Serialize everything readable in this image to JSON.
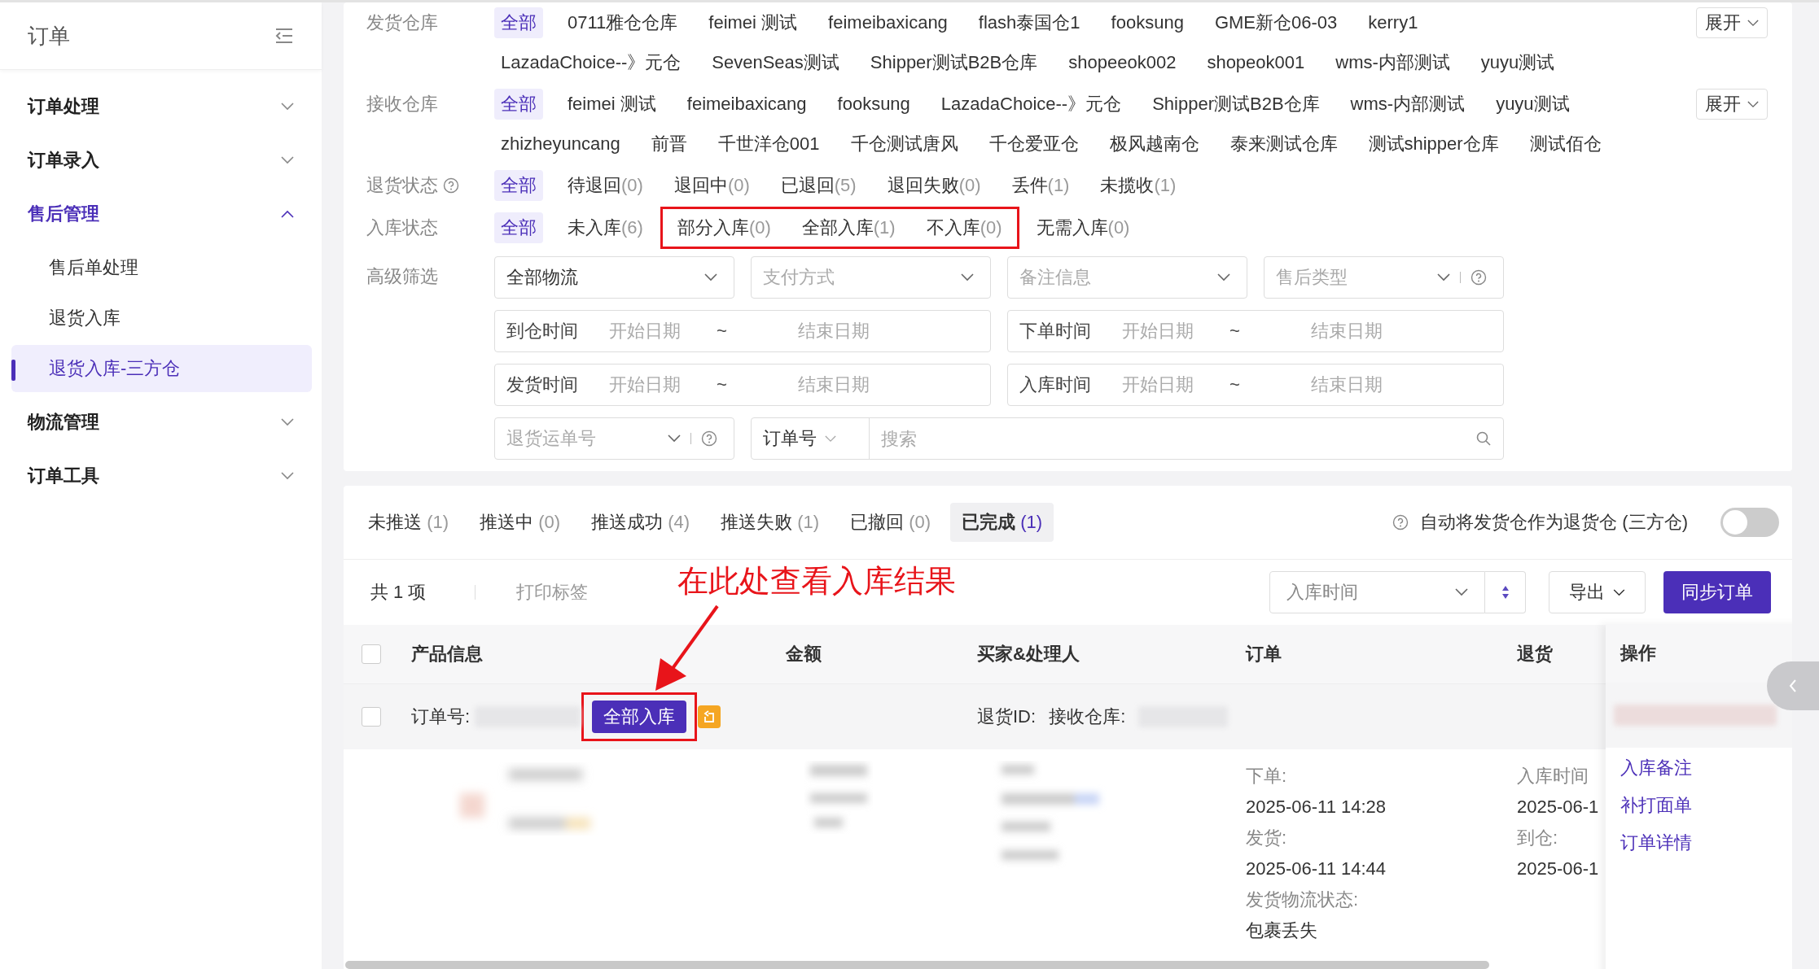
{
  "sidebar": {
    "title": "订单",
    "items": [
      {
        "label": "订单处理",
        "expanded": false
      },
      {
        "label": "订单录入",
        "expanded": false
      },
      {
        "label": "售后管理",
        "expanded": true,
        "children": [
          {
            "label": "售后单处理",
            "selected": false
          },
          {
            "label": "退货入库",
            "selected": false
          },
          {
            "label": "退货入库-三方仓",
            "selected": true
          }
        ]
      },
      {
        "label": "物流管理",
        "expanded": false
      },
      {
        "label": "订单工具",
        "expanded": false
      }
    ]
  },
  "filters": [
    {
      "label": "发货仓库",
      "expand_button": "展开",
      "options": [
        {
          "label": "全部",
          "selected": true
        },
        {
          "label": "0711雅仓仓库",
          "selected": false
        },
        {
          "label": "feimei 测试",
          "selected": false
        },
        {
          "label": "feimeibaxicang",
          "selected": false
        },
        {
          "label": "flash泰国仓1",
          "selected": false
        },
        {
          "label": "fooksung",
          "selected": false
        },
        {
          "label": "GME新仓06-03",
          "selected": false
        },
        {
          "label": "kerry1",
          "selected": false
        },
        {
          "label": "LazadaChoice--》元仓",
          "selected": false
        },
        {
          "label": "SevenSeas测试",
          "selected": false
        },
        {
          "label": "Shipper测试B2B仓库",
          "selected": false
        },
        {
          "label": "shopeeok002",
          "selected": false
        },
        {
          "label": "shopeok001",
          "selected": false
        },
        {
          "label": "wms-内部测试",
          "selected": false
        },
        {
          "label": "yuyu测试",
          "selected": false
        }
      ]
    },
    {
      "label": "接收仓库",
      "expand_button": "展开",
      "options": [
        {
          "label": "全部",
          "selected": true
        },
        {
          "label": "feimei 测试",
          "selected": false
        },
        {
          "label": "feimeibaxicang",
          "selected": false
        },
        {
          "label": "fooksung",
          "selected": false
        },
        {
          "label": "LazadaChoice--》元仓",
          "selected": false
        },
        {
          "label": "Shipper测试B2B仓库",
          "selected": false
        },
        {
          "label": "wms-内部测试",
          "selected": false
        },
        {
          "label": "yuyu测试",
          "selected": false
        },
        {
          "label": "zhizheyuncang",
          "selected": false
        },
        {
          "label": "前晋",
          "selected": false
        },
        {
          "label": "千世洋仓001",
          "selected": false
        },
        {
          "label": "千仓测试唐风",
          "selected": false
        },
        {
          "label": "千仓爱亚仓",
          "selected": false
        },
        {
          "label": "极风越南仓",
          "selected": false
        },
        {
          "label": "泰来测试仓库",
          "selected": false
        },
        {
          "label": "测试shipper仓库",
          "selected": false
        },
        {
          "label": "测试佰仓",
          "selected": false
        }
      ]
    },
    {
      "label": "退货状态",
      "help": true,
      "options": [
        {
          "label": "全部",
          "selected": true
        },
        {
          "label": "待退回",
          "count": "(0)",
          "selected": false
        },
        {
          "label": "退回中",
          "count": "(0)",
          "selected": false
        },
        {
          "label": "已退回",
          "count": "(5)",
          "selected": false
        },
        {
          "label": "退回失败",
          "count": "(0)",
          "selected": false
        },
        {
          "label": "丢件",
          "count": "(1)",
          "selected": false
        },
        {
          "label": "未揽收",
          "count": "(1)",
          "selected": false
        }
      ]
    },
    {
      "label": "入库状态",
      "options": [
        {
          "label": "全部",
          "selected": true
        },
        {
          "label": "未入库",
          "count": "(6)",
          "selected": false
        },
        {
          "label": "部分入库",
          "count": "(0)",
          "selected": false,
          "highlighted": true
        },
        {
          "label": "全部入库",
          "count": "(1)",
          "selected": false,
          "highlighted": true
        },
        {
          "label": "不入库",
          "count": "(0)",
          "selected": false,
          "highlighted": true
        },
        {
          "label": "无需入库",
          "count": "(0)",
          "selected": false
        }
      ]
    }
  ],
  "advanced": {
    "label": "高级筛选",
    "fields": [
      {
        "kind": "select",
        "value": "全部物流"
      },
      {
        "kind": "select",
        "placeholder": "支付方式"
      },
      {
        "kind": "select",
        "placeholder": "备注信息"
      },
      {
        "kind": "select",
        "placeholder": "售后类型",
        "help": true
      },
      {
        "kind": "date_range",
        "label": "到仓时间",
        "start": "开始日期",
        "separator": "~",
        "end": "结束日期"
      },
      {
        "kind": "date_range",
        "label": "下单时间",
        "start": "开始日期",
        "separator": "~",
        "end": "结束日期"
      },
      {
        "kind": "date_range",
        "label": "发货时间",
        "start": "开始日期",
        "separator": "~",
        "end": "结束日期"
      },
      {
        "kind": "date_range",
        "label": "入库时间",
        "start": "开始日期",
        "separator": "~",
        "end": "结束日期"
      },
      {
        "kind": "select",
        "placeholder": "退货运单号",
        "help": true
      },
      {
        "kind": "search",
        "field": "订单号",
        "placeholder": "搜索"
      }
    ]
  },
  "status_tabs": [
    {
      "label": "未推送",
      "count": "(1)",
      "selected": false
    },
    {
      "label": "推送中",
      "count": "(0)",
      "selected": false
    },
    {
      "label": "推送成功",
      "count": "(4)",
      "selected": false
    },
    {
      "label": "推送失败",
      "count": "(1)",
      "selected": false
    },
    {
      "label": "已撤回",
      "count": "(0)",
      "selected": false
    },
    {
      "label": "已完成",
      "count": "(1)",
      "selected": true
    }
  ],
  "auto_toggle": {
    "label": "自动将发货仓作为退货仓 (三方仓)",
    "on": false
  },
  "toolbar": {
    "total": "共 1 项",
    "print": "打印标签",
    "sort": "入库时间",
    "export": "导出",
    "sync": "同步订单"
  },
  "annotation": "在此处查看入库结果",
  "table": {
    "select_all_checked": false,
    "columns": [
      "产品信息",
      "金额",
      "买家&处理人",
      "订单",
      "退货",
      "操作"
    ],
    "rows": [
      {
        "checked": false,
        "order_label": "订单号:",
        "status": "全部入库",
        "status_highlighted": true,
        "return_id": "退货ID:",
        "warehouse": "接收仓库:",
        "order_times": [
          {
            "label": "下单:",
            "value": "2025-06-11 14:28"
          },
          {
            "label": "发货:",
            "value": "2025-06-11 14:44"
          },
          {
            "label": "发货物流状态:",
            "value": "包裹丢失"
          }
        ],
        "return_times": [
          {
            "label": "入库时间",
            "value": "2025-06-1"
          },
          {
            "label": "到仓:",
            "value": "2025-06-1"
          }
        ],
        "actions": [
          "入库备注",
          "补打面单",
          "订单详情"
        ]
      }
    ]
  }
}
